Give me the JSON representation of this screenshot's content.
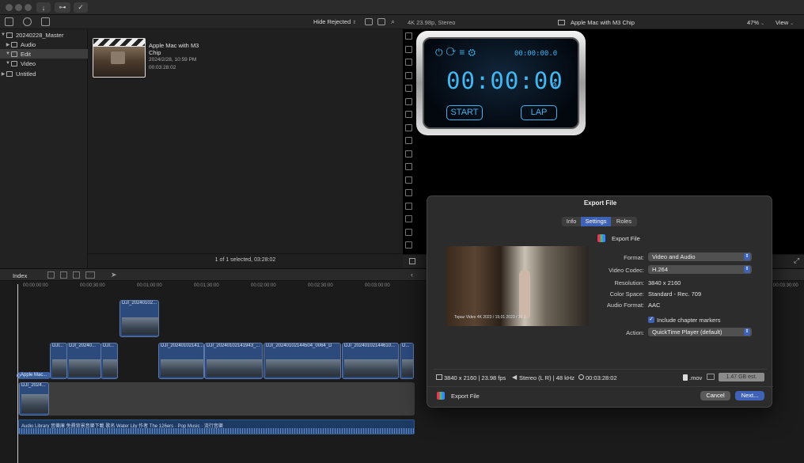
{
  "browser_toolbar": {
    "filter": "Hide Rejected"
  },
  "library": {
    "items": [
      {
        "label": "20240228_Master",
        "kind": "library"
      },
      {
        "label": "Audio",
        "kind": "event"
      },
      {
        "label": "Edit",
        "kind": "event",
        "selected": true
      },
      {
        "label": "Video",
        "kind": "event"
      },
      {
        "label": "Untitled",
        "kind": "library"
      }
    ]
  },
  "browser": {
    "clip_title": "Apple Mac with M3 Chip",
    "clip_date": "2024/2/28, 10:59 PM",
    "clip_duration": "00:03:28:02",
    "status": "1 of 1 selected, 03:28:02"
  },
  "viewer": {
    "format": "4K 23.98p, Stereo",
    "title": "Apple Mac with M3 Chip",
    "zoom": "47%",
    "view_menu": "View",
    "stopwatch_small": "00:00:00.0",
    "stopwatch_big": "00:00:00",
    "stopwatch_frac": "0",
    "start": "START",
    "lap": "LAP"
  },
  "timeline": {
    "index": "Index",
    "ruler": [
      "00:00:00:00",
      "00:00:30:00",
      "00:01:00:00",
      "00:01:30:00",
      "00:02:00:00",
      "00:02:30:00",
      "00:03:00:00",
      "00:03:30:00"
    ],
    "connected_clip": "DJI_20240102...",
    "primary_label": "Apple Mac...",
    "clips": [
      "DJI...",
      "DJI_20240...",
      "DJI...",
      "DJI_20240102141...",
      "DJI_20240102141943_...",
      "DJI_20240102144504_0064_D",
      "DJI_20240102144610...",
      "D..."
    ],
    "lower_clip": "DJI_2024...",
    "audio_label": "Audio Library 音樂庫 免費背景音樂下載 歌名 Water Lily 作者 The 126ers · Pop Music · 流行音樂"
  },
  "dialog": {
    "title": "Export File",
    "tabs": [
      "Info",
      "Settings",
      "Roles"
    ],
    "active_tab": "Settings",
    "destination": "Export File",
    "fields": [
      {
        "label": "Format:",
        "value": "Video and Audio",
        "popup": true
      },
      {
        "label": "Video Codec:",
        "value": "H.264",
        "popup": true
      },
      {
        "label": "Resolution:",
        "value": "3840 x 2160",
        "popup": false
      },
      {
        "label": "Color Space:",
        "value": "Standard - Rec. 709",
        "popup": false
      },
      {
        "label": "Audio Format:",
        "value": "AAC",
        "popup": false
      }
    ],
    "chapter_markers": "Include chapter markers",
    "chapter_markers_checked": true,
    "action_label": "Action:",
    "action_value": "QuickTime Player (default)",
    "preview_caption": "Topaz Video 4K 2023 / 19,01 2023 / 16:3...",
    "summary": {
      "res_fps": "3840 x 2160 | 23.98 fps",
      "audio": "Stereo (L R) | 48 kHz",
      "duration": "00:03:28:02",
      "ext": ".mov",
      "size": "1.47 GB est."
    },
    "footer_label": "Export File",
    "cancel": "Cancel",
    "next": "Next..."
  },
  "colors": {
    "accent": "#3f61b6",
    "clip": "#2d4a7c",
    "audio": "#1d3a63"
  }
}
